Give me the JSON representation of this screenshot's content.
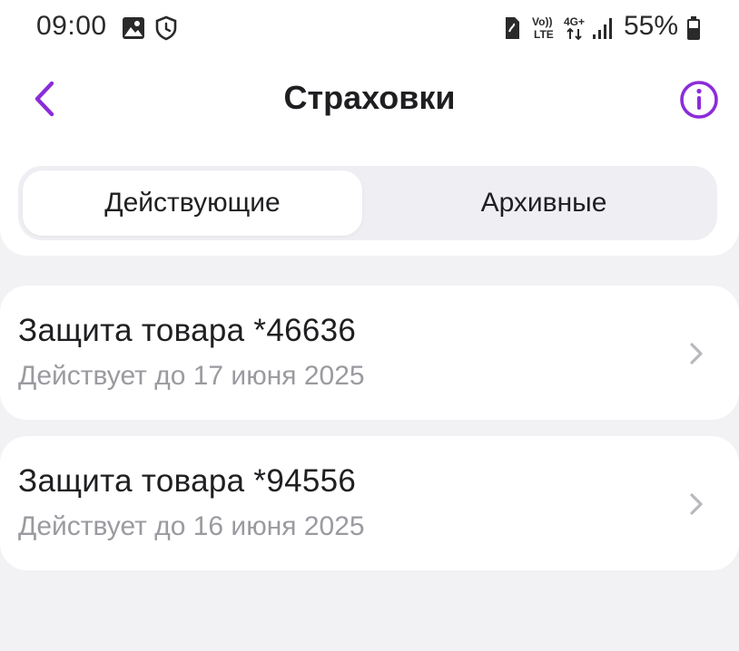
{
  "status_bar": {
    "time": "09:00",
    "battery_percent": "55%",
    "network_labels": [
      "Vo)) LTE",
      "4G+"
    ]
  },
  "header": {
    "title": "Страховки"
  },
  "tabs": [
    {
      "label": "Действующие",
      "active": true
    },
    {
      "label": "Архивные",
      "active": false
    }
  ],
  "insurances": [
    {
      "title": "Защита товара *46636",
      "subtitle": "Действует до 17 июня 2025"
    },
    {
      "title": "Защита товара *94556",
      "subtitle": "Действует до 16 июня 2025"
    }
  ],
  "colors": {
    "accent": "#8b2cd9",
    "background": "#f2f2f5",
    "surface": "#ffffff",
    "text_primary": "#1f1f22",
    "text_secondary": "#9a9aa0"
  },
  "icons": [
    "image-icon",
    "shield-icon",
    "sim-icon",
    "volte-icon",
    "4g-icon",
    "signal-icon",
    "battery-icon",
    "back-arrow-icon",
    "info-icon",
    "chevron-right-icon"
  ]
}
